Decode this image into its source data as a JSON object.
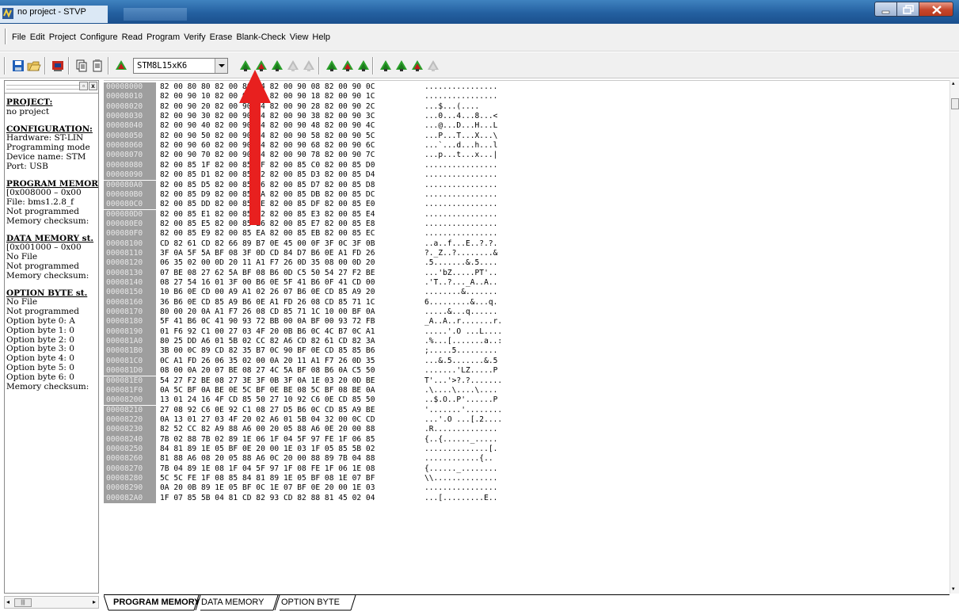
{
  "window": {
    "title": "no project - STVP"
  },
  "menu": [
    "File",
    "Edit",
    "Project",
    "Configure",
    "Read",
    "Program",
    "Verify",
    "Erase",
    "Blank-Check",
    "View",
    "Help"
  ],
  "toolbar": {
    "device": "STM8L15xK6",
    "icons": [
      "save-icon",
      "open-folder-icon",
      "settings-icon",
      "copy-icon",
      "paste-icon",
      "device-icon",
      "read-all-icon",
      "program-all-icon",
      "verify-all-icon",
      "erase-all-icon",
      "blank-check-all-icon",
      "read-current-icon",
      "program-current-icon",
      "verify-current-icon",
      "read-page-icon",
      "program-page-icon",
      "verify-page-icon",
      "erase-page-icon"
    ]
  },
  "left_panel": {
    "project_heading": "PROJECT:",
    "project_value": "no project",
    "configuration_heading": "CONFIGURATION:",
    "hardware": "Hardware: ST-LIN",
    "programming_mode": "Programming mode",
    "device_name": "Device name: STM",
    "port": "Port: USB",
    "program_memory_heading": "PROGRAM MEMORY",
    "program_memory_range": "[0x008000 – 0x00",
    "program_memory_file": "File: bms1.2.8_f",
    "program_memory_status": "Not programmed",
    "program_memory_checksum": "Memory checksum:",
    "data_memory_heading": "DATA MEMORY st.",
    "data_memory_range": "[0x001000 – 0x00",
    "data_memory_file": "No File",
    "data_memory_status": "Not programmed",
    "data_memory_checksum": "Memory checksum:",
    "option_byte_heading": "OPTION BYTE st.",
    "option_byte_file": "No File",
    "option_byte_status": "Not programmed",
    "option_bytes": [
      "Option byte 0: A",
      "Option byte 1: 0",
      "Option byte 2: 0",
      "Option byte 3: 0",
      "Option byte 4: 0",
      "Option byte 5: 0",
      "Option byte 6: 0"
    ],
    "option_byte_checksum": "Memory checksum:"
  },
  "hex_rows": [
    [
      "00008000",
      "82 00 80 80 82 00 80 04 82 00 90 08 82 00 90 0C",
      "................"
    ],
    [
      "00008010",
      "82 00 90 10 82 00 90 14 82 00 90 18 82 00 90 1C",
      "................"
    ],
    [
      "00008020",
      "82 00 90 20 82 00 90 24 82 00 90 28 82 00 90 2C",
      "...$...(...."
    ],
    [
      "00008030",
      "82 00 90 30 82 00 90 34 82 00 90 38 82 00 90 3C",
      "...0...4...8...<"
    ],
    [
      "00008040",
      "82 00 90 40 82 00 90 44 82 00 90 48 82 00 90 4C",
      "...@...D...H...L"
    ],
    [
      "00008050",
      "82 00 90 50 82 00 90 54 82 00 90 58 82 00 90 5C",
      "...P...T...X...\\"
    ],
    [
      "00008060",
      "82 00 90 60 82 00 90 64 82 00 90 68 82 00 90 6C",
      "...`...d...h...l"
    ],
    [
      "00008070",
      "82 00 90 70 82 00 90 74 82 00 90 78 82 00 90 7C",
      "...p...t...x...|"
    ],
    [
      "00008080",
      "82 00 85 1F 82 00 85 CF 82 00 85 C0 82 00 85 D0",
      "................"
    ],
    [
      "00008090",
      "82 00 85 D1 82 00 85 D2 82 00 85 D3 82 00 85 D4",
      "................"
    ],
    [
      "000080A0",
      "82 00 85 D5 82 00 85 D6 82 00 85 D7 82 00 85 D8",
      "................"
    ],
    [
      "000080B0",
      "82 00 85 D9 82 00 85 DA 82 00 85 DB 82 00 85 DC",
      "................"
    ],
    [
      "000080C0",
      "82 00 85 DD 82 00 85 DE 82 00 85 DF 82 00 85 E0",
      "................"
    ],
    [
      "000080D0",
      "82 00 85 E1 82 00 85 E2 82 00 85 E3 82 00 85 E4",
      "................"
    ],
    [
      "000080E0",
      "82 00 85 E5 82 00 85 E6 82 00 85 E7 82 00 85 E8",
      "................"
    ],
    [
      "000080F0",
      "82 00 85 E9 82 00 85 EA 82 00 85 EB 82 00 85 EC",
      "................"
    ],
    [
      "00008100",
      "CD 82 61 CD 82 66 89 B7 0E 45 00 0F 3F 0C 3F 0B",
      "..a..f...E..?.?."
    ],
    [
      "00008110",
      "3F 0A 5F 5A BF 08 3F 0D CD 84 D7 B6 0E A1 FD 26",
      "?._Z..?........&"
    ],
    [
      "00008120",
      "06 35 02 00 0D 20 11 A1 F7 26 0D 35 08 00 0D 20",
      ".5.......&.5...."
    ],
    [
      "00008130",
      "07 BE 08 27 62 5A BF 08 B6 0D C5 50 54 27 F2 BE",
      "...'bZ.....PT'.."
    ],
    [
      "00008140",
      "08 27 54 16 01 3F 00 B6 0E 5F 41 B6 0F 41 CD 00",
      ".'T..?..._A..A.."
    ],
    [
      "00008150",
      "10 B6 0E CD 00 A9 A1 02 26 07 B6 0E CD 85 A9 20",
      "........&......."
    ],
    [
      "00008160",
      "36 B6 0E CD 85 A9 B6 0E A1 FD 26 08 CD 85 71 1C",
      "6.........&...q."
    ],
    [
      "00008170",
      "80 00 20 0A A1 F7 26 08 CD 85 71 1C 10 00 BF 0A",
      ".....&...q......"
    ],
    [
      "00008180",
      "5F 41 B6 0C 41 90 93 72 BB 00 0A BF 00 93 72 FB",
      "_A..A..r.......r."
    ],
    [
      "00008190",
      "01 F6 92 C1 00 27 03 4F 20 0B B6 0C 4C B7 0C A1",
      ".....'.O ...L...."
    ],
    [
      "000081A0",
      "80 25 DD A6 01 5B 02 CC 82 A6 CD 82 61 CD 82 3A",
      ".%...[.......a..:"
    ],
    [
      "000081B0",
      "3B 00 0C 89 CD 82 35 B7 0C 90 BF 0E CD 85 85 B6",
      ";.....5........."
    ],
    [
      "000081C0",
      "0C A1 FD 26 06 35 02 00 0A 20 11 A1 F7 26 0D 35",
      "...&.5.......&.5"
    ],
    [
      "000081D0",
      "08 00 0A 20 07 BE 08 27 4C 5A BF 08 B6 0A C5 50",
      ".......'LZ.....P"
    ],
    [
      "000081E0",
      "54 27 F2 BE 08 27 3E 3F 0B 3F 0A 1E 03 20 0D BE",
      "T'...'>?.?......."
    ],
    [
      "000081F0",
      "0A 5C BF 0A BE 0E 5C BF 0E BE 08 5C BF 08 BE 0A",
      ".\\....\\....\\...."
    ],
    [
      "00008200",
      "13 01 24 16 4F CD 85 50 27 10 92 C6 0E CD 85 50",
      "..$.O..P'......P"
    ],
    [
      "00008210",
      "27 08 92 C6 0E 92 C1 08 27 D5 B6 0C CD 85 A9 BE",
      "'.......'........"
    ],
    [
      "00008220",
      "0A 13 01 27 03 4F 20 02 A6 01 5B 04 32 00 0C CD",
      "...'.O ...[.2...."
    ],
    [
      "00008230",
      "82 52 CC 82 A9 88 A6 00 20 05 88 A6 0E 20 00 88",
      ".R.............."
    ],
    [
      "00008240",
      "7B 02 88 7B 02 89 1E 06 1F 04 5F 97 FE 1F 06 85",
      "{..{......_....."
    ],
    [
      "00008250",
      "84 81 89 1E 05 BF 0E 20 00 1E 03 1F 05 85 5B 02",
      "..............[."
    ],
    [
      "00008260",
      "81 88 A6 08 20 05 88 A6 0C 20 00 88 89 7B 04 88",
      "............{.."
    ],
    [
      "00008270",
      "7B 04 89 1E 08 1F 04 5F 97 1F 08 FE 1F 06 1E 08",
      "{......_........"
    ],
    [
      "00008280",
      "5C 5C FE 1F 08 85 84 81 89 1E 05 BF 08 1E 07 BF",
      "\\\\.............."
    ],
    [
      "00008290",
      "0A 20 0B 89 1E 05 BF 0C 1E 07 BF 0E 20 00 1E 03",
      "................"
    ],
    [
      "000082A0",
      "1F 07 85 5B 04 81 CD 82 93 CD 82 88 81 45 02 04",
      "...[.........E.."
    ]
  ],
  "tabs": [
    "PROGRAM MEMORY",
    "DATA MEMORY",
    "OPTION BYTE"
  ],
  "colors": {
    "title_bar": "#2460a0",
    "address_column": "#9e9e9e",
    "annotation_arrow": "#e8201f",
    "close_button": "#c6462b"
  }
}
